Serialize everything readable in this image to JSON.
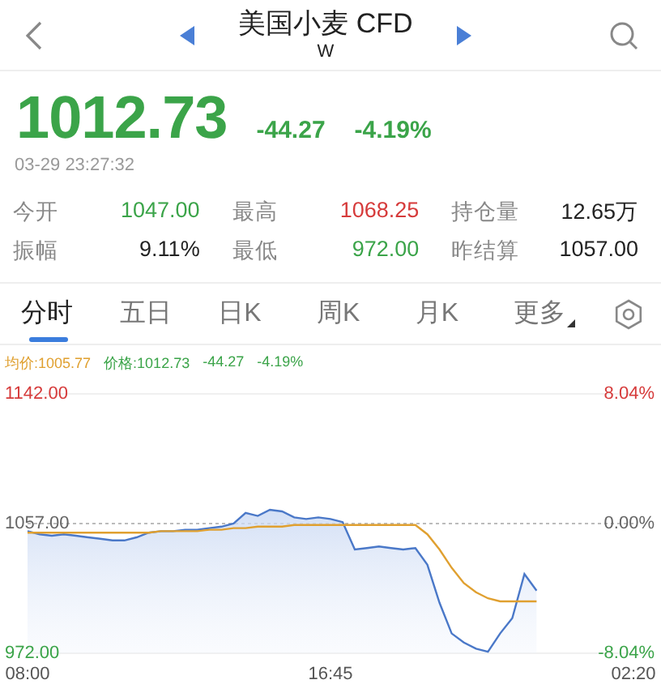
{
  "header": {
    "title": "美国小麦 CFD",
    "subtitle": "W"
  },
  "quote": {
    "price": "1012.73",
    "change": "-44.27",
    "change_pct": "-4.19%",
    "timestamp": "03-29 23:27:32"
  },
  "stats": [
    {
      "label": "今开",
      "value": "1047.00",
      "color": "#3ba449"
    },
    {
      "label": "最高",
      "value": "1068.25",
      "color": "#d63b3b"
    },
    {
      "label": "持仓量",
      "value": "12.65万",
      "color": "#222222"
    },
    {
      "label": "振幅",
      "value": "9.11%",
      "color": "#222222"
    },
    {
      "label": "最低",
      "value": "972.00",
      "color": "#3ba449"
    },
    {
      "label": "昨结算",
      "value": "1057.00",
      "color": "#222222"
    }
  ],
  "tabs": [
    {
      "label": "分时",
      "selected": true,
      "kind": "period"
    },
    {
      "label": "五日",
      "selected": false,
      "kind": "period"
    },
    {
      "label": "日K",
      "selected": false,
      "kind": "period"
    },
    {
      "label": "周K",
      "selected": false,
      "kind": "period"
    },
    {
      "label": "月K",
      "selected": false,
      "kind": "period"
    },
    {
      "label": "更多",
      "selected": false,
      "kind": "menu"
    }
  ],
  "legend": [
    {
      "label": "均价:1005.77",
      "color": "#e0a030"
    },
    {
      "label": "价格:1012.73",
      "color": "#3ba449"
    },
    {
      "label": "-44.27",
      "color": "#3ba449"
    },
    {
      "label": "-4.19%",
      "color": "#3ba449"
    }
  ],
  "chart": {
    "right_axis_labels": [
      "8.04%",
      "0.00%",
      "-8.04%"
    ],
    "chart_data": {
      "type": "area",
      "ylim": [
        972,
        1142
      ],
      "categories": [
        "08:00",
        null,
        null,
        null,
        null,
        null,
        null,
        null,
        null,
        null,
        null,
        null,
        null,
        null,
        null,
        null,
        null,
        null,
        null,
        null,
        null,
        null,
        null,
        null,
        null,
        "16:45",
        null,
        null,
        null,
        null,
        null,
        null,
        null,
        null,
        null,
        null,
        null,
        null,
        null,
        null,
        null,
        null,
        null,
        null,
        null,
        null,
        null,
        null,
        null,
        null,
        "02:20"
      ],
      "yticks": [
        {
          "value": 1142,
          "label": "1142.00"
        },
        {
          "value": 1057,
          "label": "1057.00"
        },
        {
          "value": 972,
          "label": "972.00"
        }
      ],
      "series": [
        {
          "color": "#4a78c8",
          "values": [
            1052,
            1050,
            1049,
            1050,
            1049,
            1048,
            1047,
            1046,
            1046,
            1048,
            1051,
            1052,
            1052,
            1053,
            1053,
            1054,
            1055,
            1057,
            1064,
            1062,
            1066,
            1065,
            1061,
            1060,
            1061,
            1060,
            1058,
            1040,
            1041,
            1042,
            1041,
            1040,
            1041,
            1030,
            1005,
            985,
            979,
            975,
            973,
            985,
            995,
            1024,
            1013,
            null,
            null,
            null,
            null,
            null,
            null,
            null,
            null
          ]
        },
        {
          "type": "line",
          "color": "#e0a030",
          "values": [
            1051,
            1051,
            1051,
            1051,
            1051,
            1051,
            1051,
            1051,
            1051,
            1051,
            1051,
            1052,
            1052,
            1052,
            1052,
            1053,
            1053,
            1054,
            1054,
            1055,
            1055,
            1055,
            1056,
            1056,
            1056,
            1056,
            1056,
            1056,
            1056,
            1056,
            1056,
            1056,
            1056,
            1050,
            1040,
            1028,
            1018,
            1012,
            1008,
            1006,
            1006,
            1006,
            1006,
            null,
            null,
            null,
            null,
            null,
            null,
            null,
            null
          ]
        }
      ]
    }
  }
}
